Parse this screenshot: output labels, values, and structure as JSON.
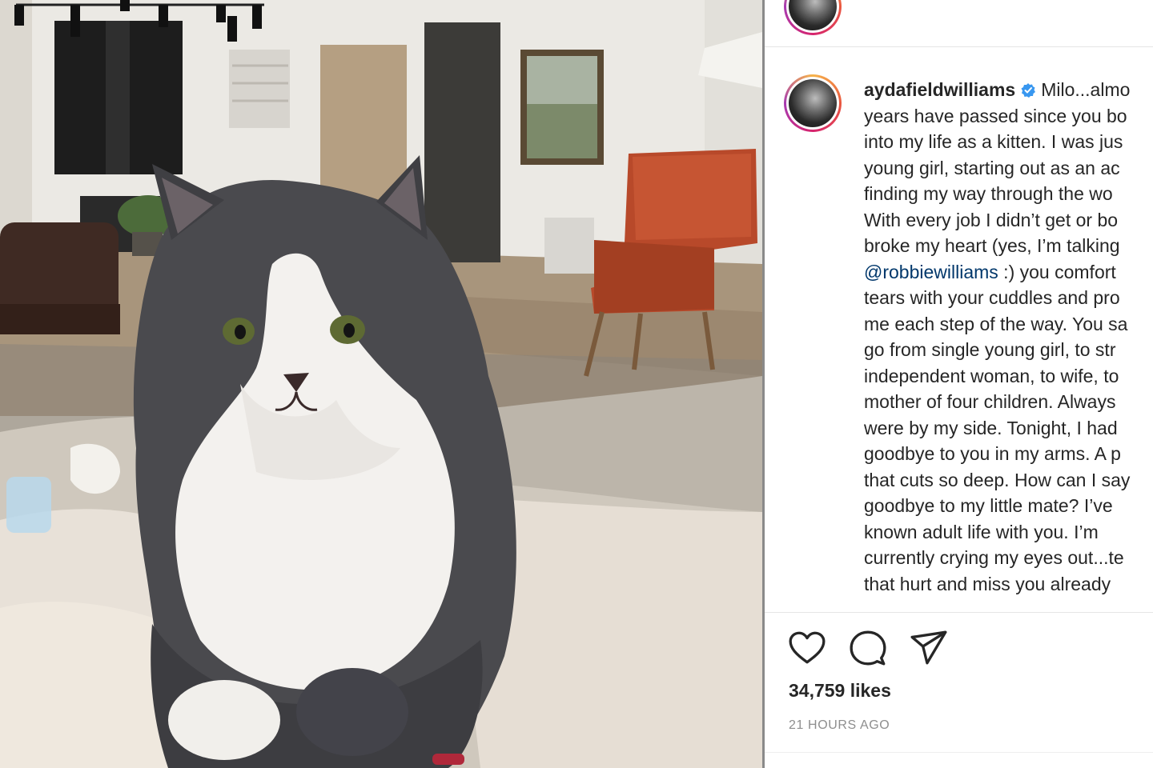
{
  "post": {
    "username": "aydafieldwilliams",
    "caption_lines": [
      "Milo...almo",
      "years have passed since you bo",
      "into my life as a kitten. I was jus",
      "young girl, starting out as an ac",
      "finding my way through the wo",
      "With every job I didn’t get or bo",
      "broke my heart (yes, I’m talking",
      "",
      "tears with your cuddles and pro",
      "me each step of the way. You sa",
      "go from single young girl, to str",
      "independent woman, to wife, to",
      "mother of four children. Always",
      "were by my side. Tonight, I had",
      "goodbye to you in my arms. A p",
      "that cuts so deep. How can I say",
      "goodbye to my little mate? I’ve",
      "known adult life with you. I’m",
      "currently crying my eyes out...te",
      "that hurt and miss you already"
    ],
    "mention": "@robbiewilliams",
    "mention_suffix": " :) you comfort",
    "likes": "34,759 likes",
    "timestamp": "21 HOURS AGO"
  },
  "icons": {
    "verified": "verified-badge-icon",
    "like": "heart-icon",
    "comment": "comment-bubble-icon",
    "share": "paper-plane-icon"
  },
  "colors": {
    "verified_blue": "#3897f0",
    "mention_blue": "#00376b",
    "text": "#262626",
    "muted": "#8e8e8e"
  }
}
